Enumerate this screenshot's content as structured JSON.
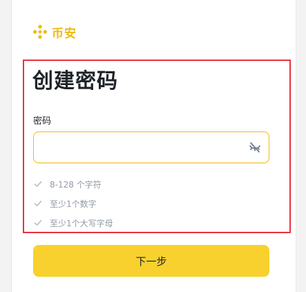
{
  "brand": {
    "name": "币安",
    "logo_icon": "binance-logo-icon",
    "color": "#f0b90b"
  },
  "page": {
    "title": "创建密码"
  },
  "password_field": {
    "label": "密码",
    "value": "",
    "placeholder": "",
    "toggle_icon": "eye-slash-icon"
  },
  "rules": [
    {
      "icon": "check-icon",
      "text": "8-128 个字符"
    },
    {
      "icon": "check-icon",
      "text": "至少1个数字"
    },
    {
      "icon": "check-icon",
      "text": "至少1个大写字母"
    }
  ],
  "next_button": {
    "label": "下一步",
    "color": "#f8d12f"
  },
  "highlight_color": "#e8323c"
}
